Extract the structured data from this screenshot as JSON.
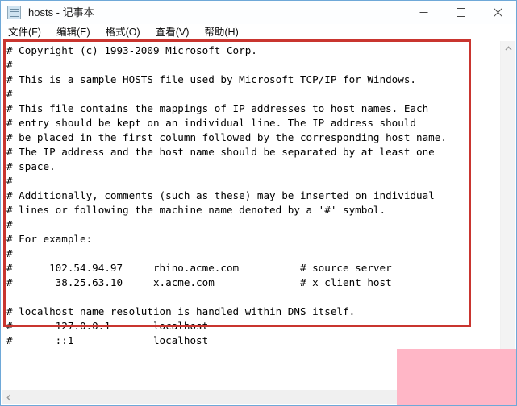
{
  "window": {
    "title": "hosts - 记事本",
    "app_icon": "notepad-icon",
    "border_color": "#6ea8d8"
  },
  "titlebar": {
    "minimize_label": "最小化",
    "maximize_label": "最大化",
    "close_label": "关闭"
  },
  "menubar": {
    "items": [
      {
        "label": "文件(F)"
      },
      {
        "label": "编辑(E)"
      },
      {
        "label": "格式(O)"
      },
      {
        "label": "查看(V)"
      },
      {
        "label": "帮助(H)"
      }
    ]
  },
  "editor": {
    "content": "# Copyright (c) 1993-2009 Microsoft Corp.\n#\n# This is a sample HOSTS file used by Microsoft TCP/IP for Windows.\n#\n# This file contains the mappings of IP addresses to host names. Each\n# entry should be kept on an individual line. The IP address should\n# be placed in the first column followed by the corresponding host name.\n# The IP address and the host name should be separated by at least one\n# space.\n#\n# Additionally, comments (such as these) may be inserted on individual\n# lines or following the machine name denoted by a '#' symbol.\n#\n# For example:\n#\n#      102.54.94.97     rhino.acme.com          # source server\n#       38.25.63.10     x.acme.com              # x client host\n\n# localhost name resolution is handled within DNS itself.\n#       127.0.0.1       localhost\n#       ::1             localhost"
  },
  "scrollbars": {
    "vertical_up_icon": "chevron-up-icon",
    "horizontal_left_icon": "chevron-left-icon"
  },
  "annotations": {
    "red_box_color": "#c9352f",
    "pink_overlay_color": "#ffb6c6"
  }
}
